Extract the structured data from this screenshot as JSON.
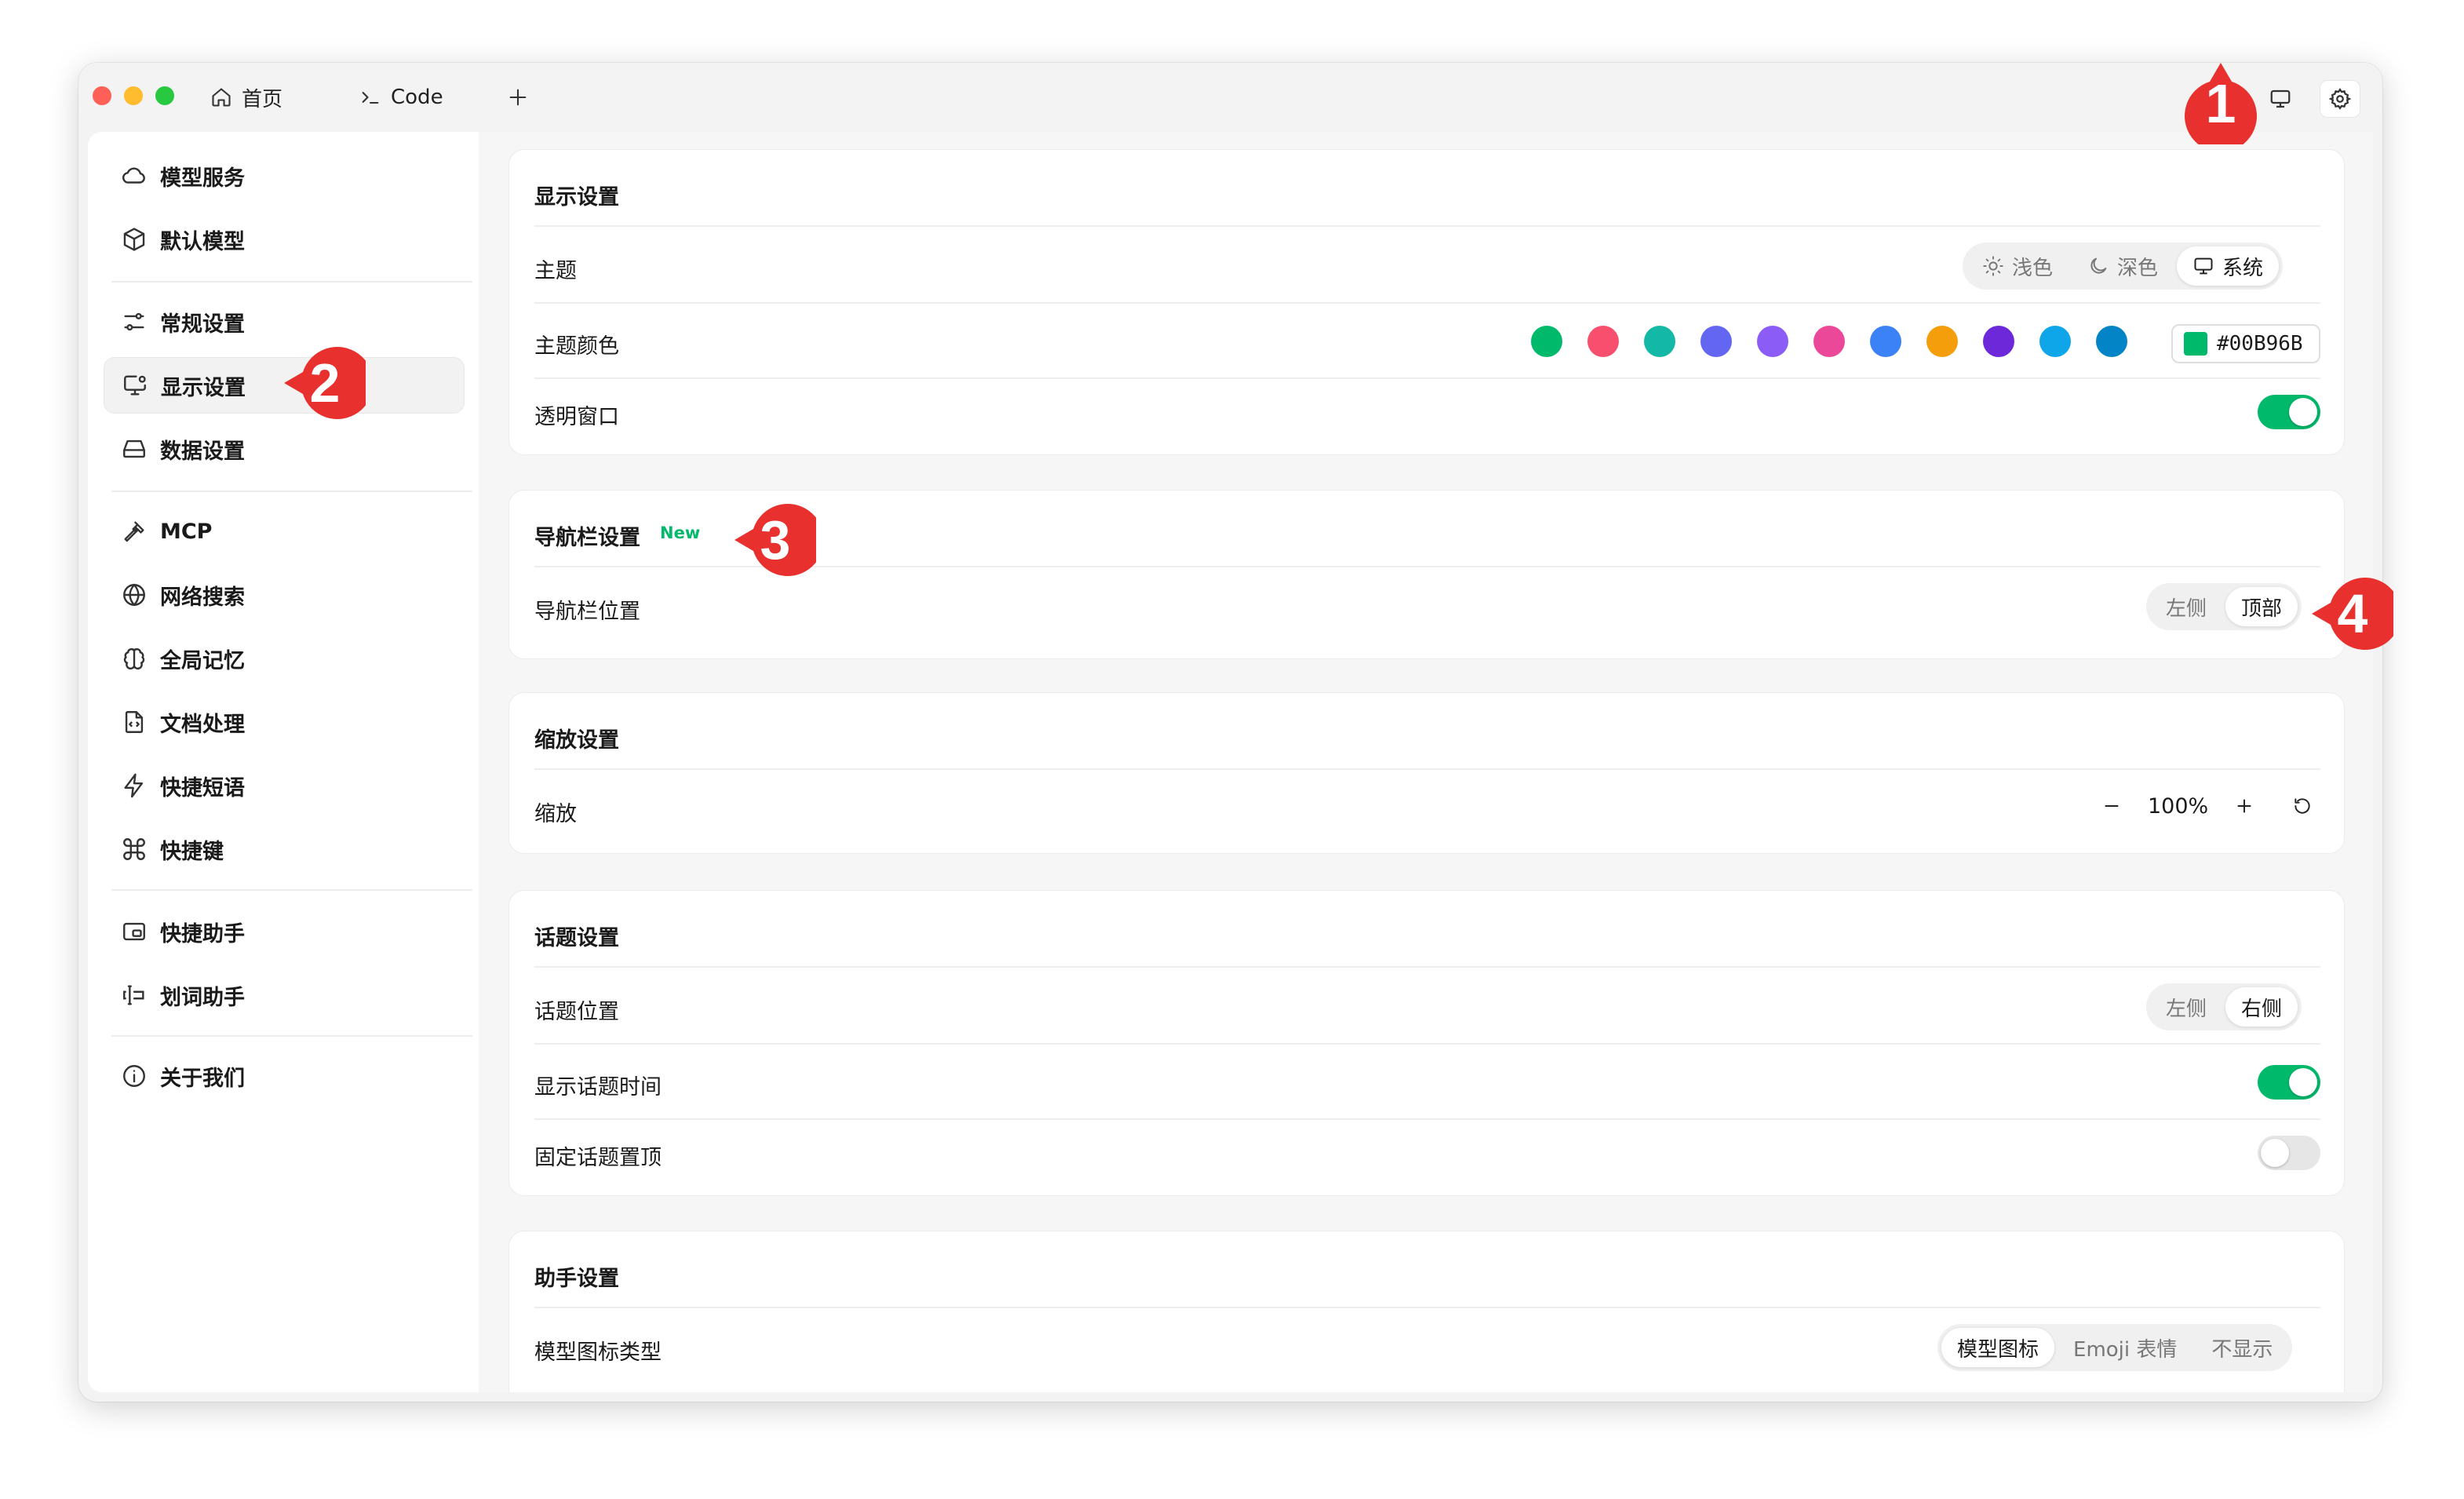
{
  "tabs": {
    "home": "首页",
    "code": "Code"
  },
  "sidebar": {
    "items": [
      {
        "label": "模型服务",
        "icon": "cloud-icon"
      },
      {
        "label": "默认模型",
        "icon": "cube-icon"
      },
      {
        "label": "常规设置",
        "icon": "sliders-icon"
      },
      {
        "label": "显示设置",
        "icon": "monitor-settings-icon",
        "active": true
      },
      {
        "label": "数据设置",
        "icon": "hard-drive-icon"
      },
      {
        "label": "MCP",
        "icon": "hammer-icon"
      },
      {
        "label": "网络搜索",
        "icon": "globe-icon"
      },
      {
        "label": "全局记忆",
        "icon": "brain-icon"
      },
      {
        "label": "文档处理",
        "icon": "file-code-icon"
      },
      {
        "label": "快捷短语",
        "icon": "zap-icon"
      },
      {
        "label": "快捷键",
        "icon": "command-icon"
      },
      {
        "label": "快捷助手",
        "icon": "app-window-icon"
      },
      {
        "label": "划词助手",
        "icon": "text-cursor-icon"
      },
      {
        "label": "关于我们",
        "icon": "info-icon"
      }
    ]
  },
  "display": {
    "title": "显示设置",
    "theme_label": "主题",
    "theme_options": {
      "light": "浅色",
      "dark": "深色",
      "system": "系统"
    },
    "theme_selected": "系统",
    "color_label": "主题颜色",
    "colors": [
      "#00B96B",
      "#F74F6D",
      "#14B8A6",
      "#6366F1",
      "#8B5CF6",
      "#EC4899",
      "#3B82F6",
      "#F59E0B",
      "#6D28D9",
      "#0EA5E9",
      "#0284C7"
    ],
    "color_value": "#00B96B",
    "transparent_label": "透明窗口",
    "transparent_on": true
  },
  "nav": {
    "title": "导航栏设置",
    "badge": "New",
    "position_label": "导航栏位置",
    "options": {
      "left": "左侧",
      "top": "顶部"
    },
    "selected": "顶部"
  },
  "zoom": {
    "title": "缩放设置",
    "label": "缩放",
    "value": "100%"
  },
  "topic": {
    "title": "话题设置",
    "position_label": "话题位置",
    "options": {
      "left": "左侧",
      "right": "右侧"
    },
    "selected": "右侧",
    "show_time_label": "显示话题时间",
    "show_time_on": true,
    "pin_label": "固定话题置顶",
    "pin_on": false
  },
  "assistant": {
    "title": "助手设置",
    "icon_type_label": "模型图标类型",
    "options": {
      "model_icon": "模型图标",
      "emoji": "Emoji 表情",
      "none": "不显示"
    },
    "selected": "模型图标"
  },
  "annotations": {
    "m1": "1",
    "m2": "2",
    "m3": "3",
    "m4": "4",
    "color": "#E8312E"
  }
}
